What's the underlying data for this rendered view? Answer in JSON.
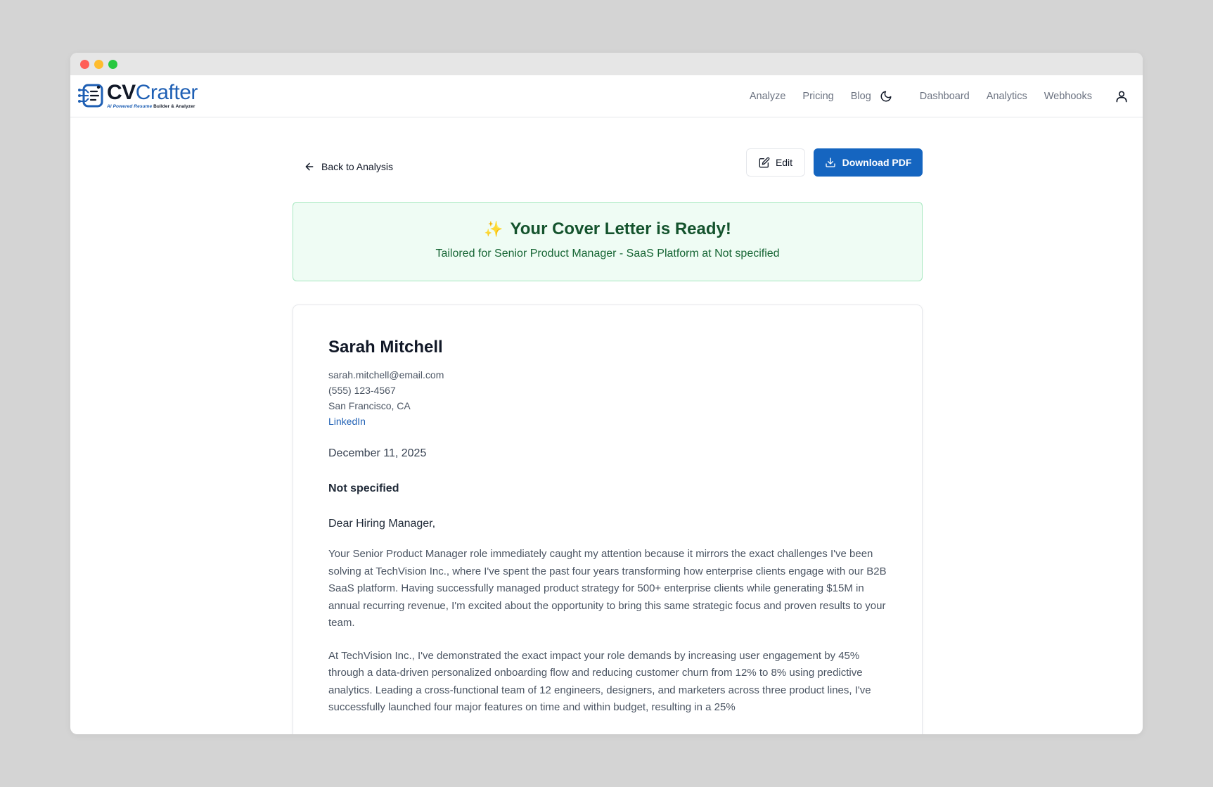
{
  "nav": {
    "logo": {
      "brand_a": "CV",
      "brand_b": "Crafter",
      "tagline_a": "AI Powered Resume",
      "tagline_b": "Builder & Analyzer"
    },
    "links": [
      "Analyze",
      "Pricing",
      "Blog"
    ],
    "links_right": [
      "Dashboard",
      "Analytics",
      "Webhooks"
    ]
  },
  "toolbar": {
    "back_label": "Back to Analysis",
    "edit_label": "Edit",
    "download_label": "Download PDF"
  },
  "banner": {
    "icon": "✨",
    "title": "Your Cover Letter is Ready!",
    "subtitle": "Tailored for Senior Product Manager - SaaS Platform at Not specified"
  },
  "letter": {
    "name": "Sarah Mitchell",
    "email": "sarah.mitchell@email.com",
    "phone": "(555) 123-4567",
    "location": "San Francisco, CA",
    "linkedin": "LinkedIn",
    "date": "December 11, 2025",
    "company": "Not specified",
    "salutation": "Dear Hiring Manager,",
    "paragraphs": [
      "Your Senior Product Manager role immediately caught my attention because it mirrors the exact challenges I've been solving at TechVision Inc., where I've spent the past four years transforming how enterprise clients engage with our B2B SaaS platform. Having successfully managed product strategy for 500+ enterprise clients while generating $15M in annual recurring revenue, I'm excited about the opportunity to bring this same strategic focus and proven results to your team.",
      "At TechVision Inc., I've demonstrated the exact impact your role demands by increasing user engagement by 45% through a data-driven personalized onboarding flow and reducing customer churn from 12% to 8% using predictive analytics. Leading a cross-functional team of 12 engineers, designers, and marketers across three product lines, I've successfully launched four major features on time and within budget, resulting in a 25%"
    ]
  },
  "colors": {
    "primary": "#1565c0",
    "banner_bg": "#effcf4",
    "banner_border": "#a7e8c0",
    "banner_text": "#14532d"
  }
}
